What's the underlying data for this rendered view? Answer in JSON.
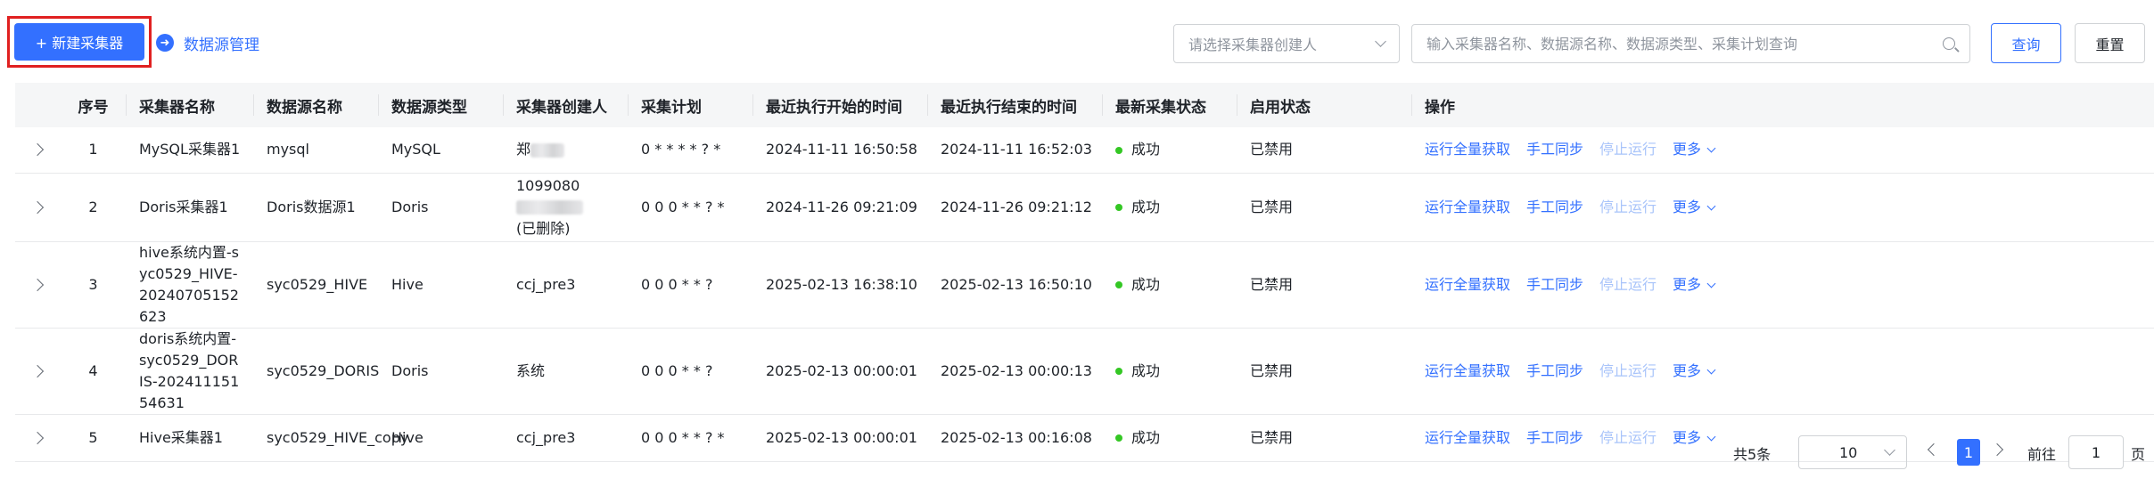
{
  "toolbar": {
    "new_button_label": "+ 新建采集器",
    "datasource_link_label": "数据源管理",
    "creator_select_placeholder": "请选择采集器创建人",
    "search_placeholder": "输入采集器名称、数据源名称、数据源类型、采集计划查询",
    "query_label": "查询",
    "reset_label": "重置",
    "icons": {
      "datasource": "arrow-right-circle-icon",
      "search": "search-icon",
      "select": "chevron-down-icon"
    },
    "highlight_color": "#e02020",
    "accent_color": "#3370ff"
  },
  "table": {
    "columns": [
      "序号",
      "采集器名称",
      "数据源名称",
      "数据源类型",
      "采集器创建人",
      "采集计划",
      "最近执行开始的时间",
      "最近执行结束的时间",
      "最新采集状态",
      "启用状态",
      "操作"
    ],
    "rows": [
      {
        "index": "1",
        "name": "MySQL采集器1",
        "source": "mysql",
        "type": "MySQL",
        "creator": "郑",
        "creator_note": "",
        "plan": "0 * * * * ? *",
        "start": "2024-11-11 16:50:58",
        "end": "2024-11-11 16:52:03",
        "status": "成功",
        "enabled": "已禁用"
      },
      {
        "index": "2",
        "name": "Doris采集器1",
        "source": "Doris数据源1",
        "type": "Doris",
        "creator": "1099080",
        "creator_note": "(已删除)",
        "plan": "0 0 0 * * ? *",
        "start": "2024-11-26 09:21:09",
        "end": "2024-11-26 09:21:12",
        "status": "成功",
        "enabled": "已禁用"
      },
      {
        "index": "3",
        "name": "hive系统内置-syc0529_HIVE-20240705152623",
        "source": "syc0529_HIVE",
        "type": "Hive",
        "creator": "ccj_pre3",
        "creator_note": "",
        "plan": "0 0 0 * * ?",
        "start": "2025-02-13 16:38:10",
        "end": "2025-02-13 16:50:10",
        "status": "成功",
        "enabled": "已禁用"
      },
      {
        "index": "4",
        "name": "doris系统内置-syc0529_DORIS-20241115154631",
        "source": "syc0529_DORIS",
        "type": "Doris",
        "creator": "系统",
        "creator_note": "",
        "plan": "0 0 0 * * ?",
        "start": "2025-02-13 00:00:01",
        "end": "2025-02-13 00:00:13",
        "status": "成功",
        "enabled": "已禁用"
      },
      {
        "index": "5",
        "name": "Hive采集器1",
        "source": "syc0529_HIVE_copy",
        "type": "Hive",
        "creator": "ccj_pre3",
        "creator_note": "",
        "plan": "0 0 0 * * ? *",
        "start": "2025-02-13 00:00:01",
        "end": "2025-02-13 00:16:08",
        "status": "成功",
        "enabled": "已禁用"
      }
    ],
    "actions": {
      "run_full": "运行全量获取",
      "manual_sync": "手工同步",
      "stop": "停止运行",
      "more": "更多"
    },
    "status_color": "#34c724"
  },
  "pagination": {
    "total_text": "共5条",
    "page_size": "10",
    "current_page": "1",
    "goto_label": "前往",
    "goto_value": "1",
    "page_unit": "页"
  }
}
